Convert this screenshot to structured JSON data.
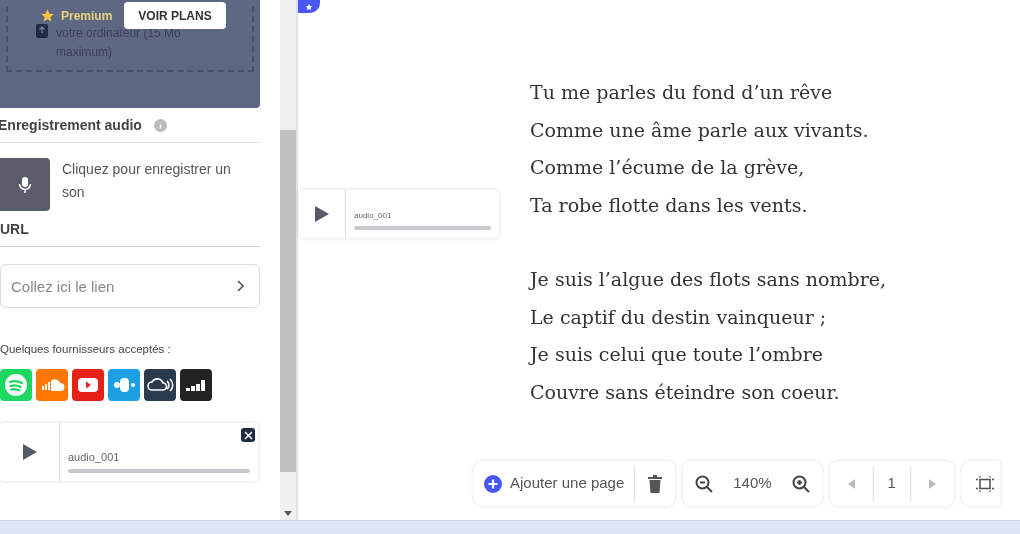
{
  "upload": {
    "text": "votre ordinateur (15 Mo maximum)",
    "premium_label": "Premium",
    "plans_button": "VOIR PLANS"
  },
  "recording": {
    "title": "Enregistrement audio",
    "hint": "Cliquez pour enregistrer un son"
  },
  "url": {
    "title": "URL",
    "placeholder": "Collez ici le lien"
  },
  "providers": {
    "label": "Quelques fournisseurs acceptés :",
    "items": [
      {
        "kind": "spotify",
        "color": "#1ed760"
      },
      {
        "kind": "soundcloud",
        "color": "#ff7700"
      },
      {
        "kind": "youtube",
        "color": "#e62117"
      },
      {
        "kind": "bandcamp",
        "color": "#1da0e3"
      },
      {
        "kind": "cloud",
        "color": "#2b3a4c"
      },
      {
        "kind": "deezer",
        "color": "#222222"
      }
    ]
  },
  "sidebar_audio": {
    "name": "audio_001"
  },
  "canvas_audio": {
    "name": "audio_001"
  },
  "poem": [
    [
      "Tu me parles du fond d’un rêve",
      "Comme une âme parle aux vivants.",
      "Comme l’écume de la grève,",
      "Ta robe flotte dans les vents."
    ],
    [
      "Je suis l’algue des flots sans nombre,",
      "Le captif du destin vainqueur ;",
      "Je suis celui que toute l’ombre",
      "Couvre sans éteindre son coeur."
    ]
  ],
  "toolbar": {
    "add_page": "Ajouter une page",
    "zoom": "140%",
    "page": "1"
  }
}
